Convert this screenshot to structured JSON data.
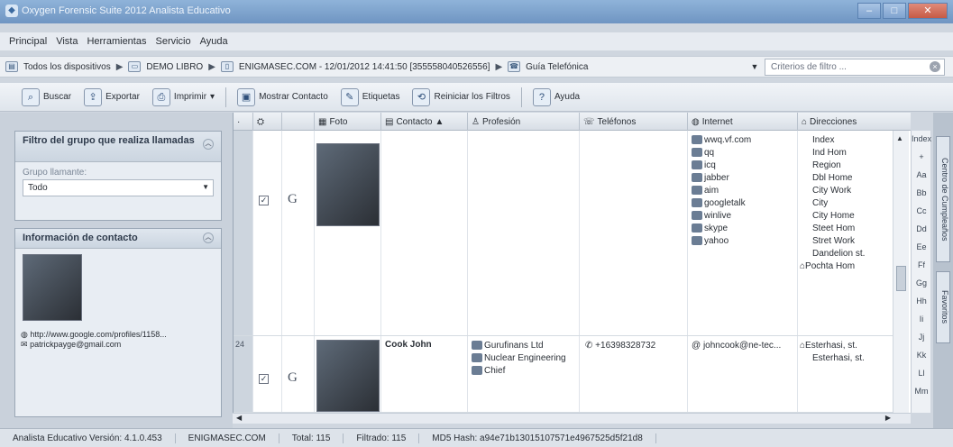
{
  "window": {
    "title": "Oxygen Forensic Suite 2012 Analista Educativo"
  },
  "menu": [
    "Principal",
    "Vista",
    "Herramientas",
    "Servicio",
    "Ayuda"
  ],
  "breadcrumb": {
    "items": [
      "Todos los dispositivos",
      "DEMO LIBRO",
      "ENIGMASEC.COM - 12/01/2012 14:41:50 [355558040526556]",
      "Guía Telefónica"
    ],
    "filter_placeholder": "Criterios de filtro ..."
  },
  "toolbar": {
    "search": "Buscar",
    "export": "Exportar",
    "print": "Imprimir",
    "show_contact": "Mostrar Contacto",
    "labels": "Etiquetas",
    "reset_filters": "Reiniciar los Filtros",
    "help": "Ayuda"
  },
  "filter_group": {
    "title": "Filtro del grupo que realiza llamadas",
    "field_label": "Grupo llamante:",
    "value": "Todo"
  },
  "contact_info": {
    "title": "Información de contacto",
    "link": "http://www.google.com/profiles/1158...",
    "email": "patrickpayge@gmail.com"
  },
  "columns": [
    "Foto",
    "Contacto",
    "Profesión",
    "Teléfonos",
    "Internet",
    "Direcciones"
  ],
  "rows": [
    {
      "num": "",
      "contact": "",
      "profession": [],
      "phone": "",
      "internet": [
        "wwq.vf.com",
        "qq",
        "icq",
        "jabber",
        "aim",
        "googletalk",
        "winlive",
        "skype",
        "yahoo"
      ],
      "addresses": [
        "Index",
        "Ind Hom",
        "Region",
        "Dbl Home",
        "City Work",
        "City",
        "City Home",
        "Steet Hom",
        "Stret Work",
        "Dandelion st.",
        "Pochta Hom"
      ]
    },
    {
      "num": "24",
      "contact": "Cook John",
      "profession": [
        "Gurufinans Ltd",
        "Nuclear Engineering",
        "Chief"
      ],
      "phone": "+16398328732",
      "internet": [
        "johncook@ne-tec..."
      ],
      "addresses": [
        "Esterhasi, st.",
        "Esterhasi, st."
      ]
    }
  ],
  "alphabet": [
    "Index",
    "+",
    "Aa",
    "Bb",
    "Cc",
    "Dd",
    "Ee",
    "Ff",
    "Gg",
    "Hh",
    "Ii",
    "Jj",
    "Kk",
    "Ll",
    "Mm"
  ],
  "side_tabs": [
    "Centro de Cumpleaños",
    "Favoritos"
  ],
  "status": {
    "version": "Analista Educativo Versión: 4.1.0.453",
    "device": "ENIGMASEC.COM",
    "total": "Total: 115",
    "filtered": "Filtrado: 115",
    "md5": "MD5 Hash: a94e71b13015107571e4967525d5f21d8"
  }
}
